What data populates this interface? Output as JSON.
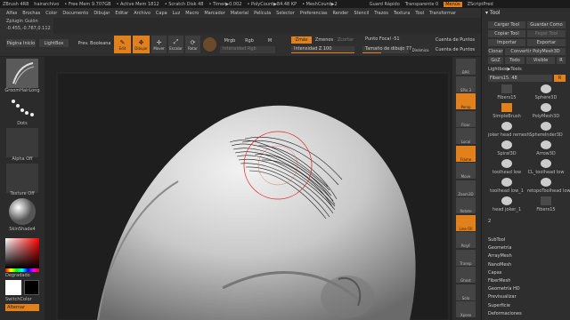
{
  "titlebar": {
    "app": "ZBrush 4R8",
    "file": "hairarchivo",
    "free_mem": "• Free Mem 9.707GB",
    "active_mem": "• Active Mem 1812",
    "scratch": "• Scratch Disk 48",
    "timer": "• Timer▶0.002",
    "polycount": "• PolyCount▶84.48 KP",
    "meshcount": "• MeshCount▶2",
    "quicksave": "Guard Rápido",
    "transparency": "Transparente 0",
    "menus": "Menús",
    "script": "ZScriptPred"
  },
  "menubar": [
    "Alfas",
    "Brochas",
    "Color",
    "Documento",
    "Dibujar",
    "Editar",
    "Archivo",
    "Capa",
    "Luz",
    "Macro",
    "Marcador",
    "Material",
    "Película",
    "Selector",
    "Preferencias",
    "Render",
    "Stencil",
    "Trazos",
    "Textura",
    "Tool",
    "Transformar"
  ],
  "subbar": {
    "zplugin": "Zplugin",
    "zscript": "Guión",
    "coord": "-0.455,-0.787,0.112"
  },
  "shelf": {
    "home": "Página Inicio",
    "lightbox": "LightBox",
    "boolean": "Prev. Booleana",
    "edit": "Edit",
    "draw": "Dibujar",
    "move": "Mover",
    "scale": "Escalar",
    "rotate": "Rotar",
    "mrgb": "Mrgb",
    "rgb": "Rgb",
    "m": "M",
    "zadd": "Zmás",
    "zsub": "Zmenos",
    "zcut": "Zcortar",
    "rgb_intensity": "Intensidad Rgb",
    "z_intensity": "Intensidad Z 100",
    "focal": "Punto Focal -51",
    "draw_size": "Tamaño de dibujo 77",
    "dynamic": "Dinámico",
    "active_points": "Cuenta de Puntos",
    "total_points": "Cuenta de Puntos",
    "z_intensity_value": 1.0,
    "draw_size_fill": 0.4
  },
  "leftpanel": {
    "brush": "GroomHairLong",
    "stroke": "Dots",
    "alpha": "Alpha Off",
    "texture": "Texture Off",
    "material": "SkinShade4",
    "gradient": "Degradado",
    "switch": "SwitchColor",
    "alternate": "Alternar"
  },
  "rightstrip": [
    "BPR",
    "SPix 3",
    "Persp",
    "Floor",
    "Local",
    "Frame",
    "Move",
    "Zoom3D",
    "Rotate",
    "Line Fill",
    "PolyF",
    "Transp",
    "Ghost",
    "Solo",
    "Xpose"
  ],
  "toolpanel": {
    "title": "Tool",
    "load": "Cargar Tool",
    "save": "Guardar Como",
    "copy": "Copiar Tool",
    "paste": "Pegar Tool",
    "import": "Importar",
    "export": "Exportar",
    "clone": "Clonar",
    "polymesh": "Convertir PolyMesh3D",
    "goz": "GoZ",
    "all": "Todo",
    "visible": "Visible",
    "r": "R",
    "lightbox_tools": "Lightbox▶Tools",
    "current_tool": "Fibers15. 48",
    "count": "2",
    "tools": [
      "Fibers15",
      "Sphere3D",
      "SimpleBrush",
      "PolyMesh3D",
      "joker head remesh",
      "SphereInder3D",
      "Spiral3D",
      "Arrow3D",
      "toolhead low",
      "CL_toolhead low",
      "toolhead low_1",
      "retopoToolhead low",
      "head joker_1",
      "Fibers15"
    ],
    "submenus": [
      "SubTool",
      "Geometría",
      "ArrayMesh",
      "NanoMesh",
      "Capas",
      "FiberMesh",
      "Geometría HD",
      "Previsualizar",
      "Superficie",
      "Deformaciones"
    ]
  },
  "colors": {
    "accent": "#e2811c",
    "bg": "#2a2a2a",
    "panel": "#2e2e2e"
  }
}
